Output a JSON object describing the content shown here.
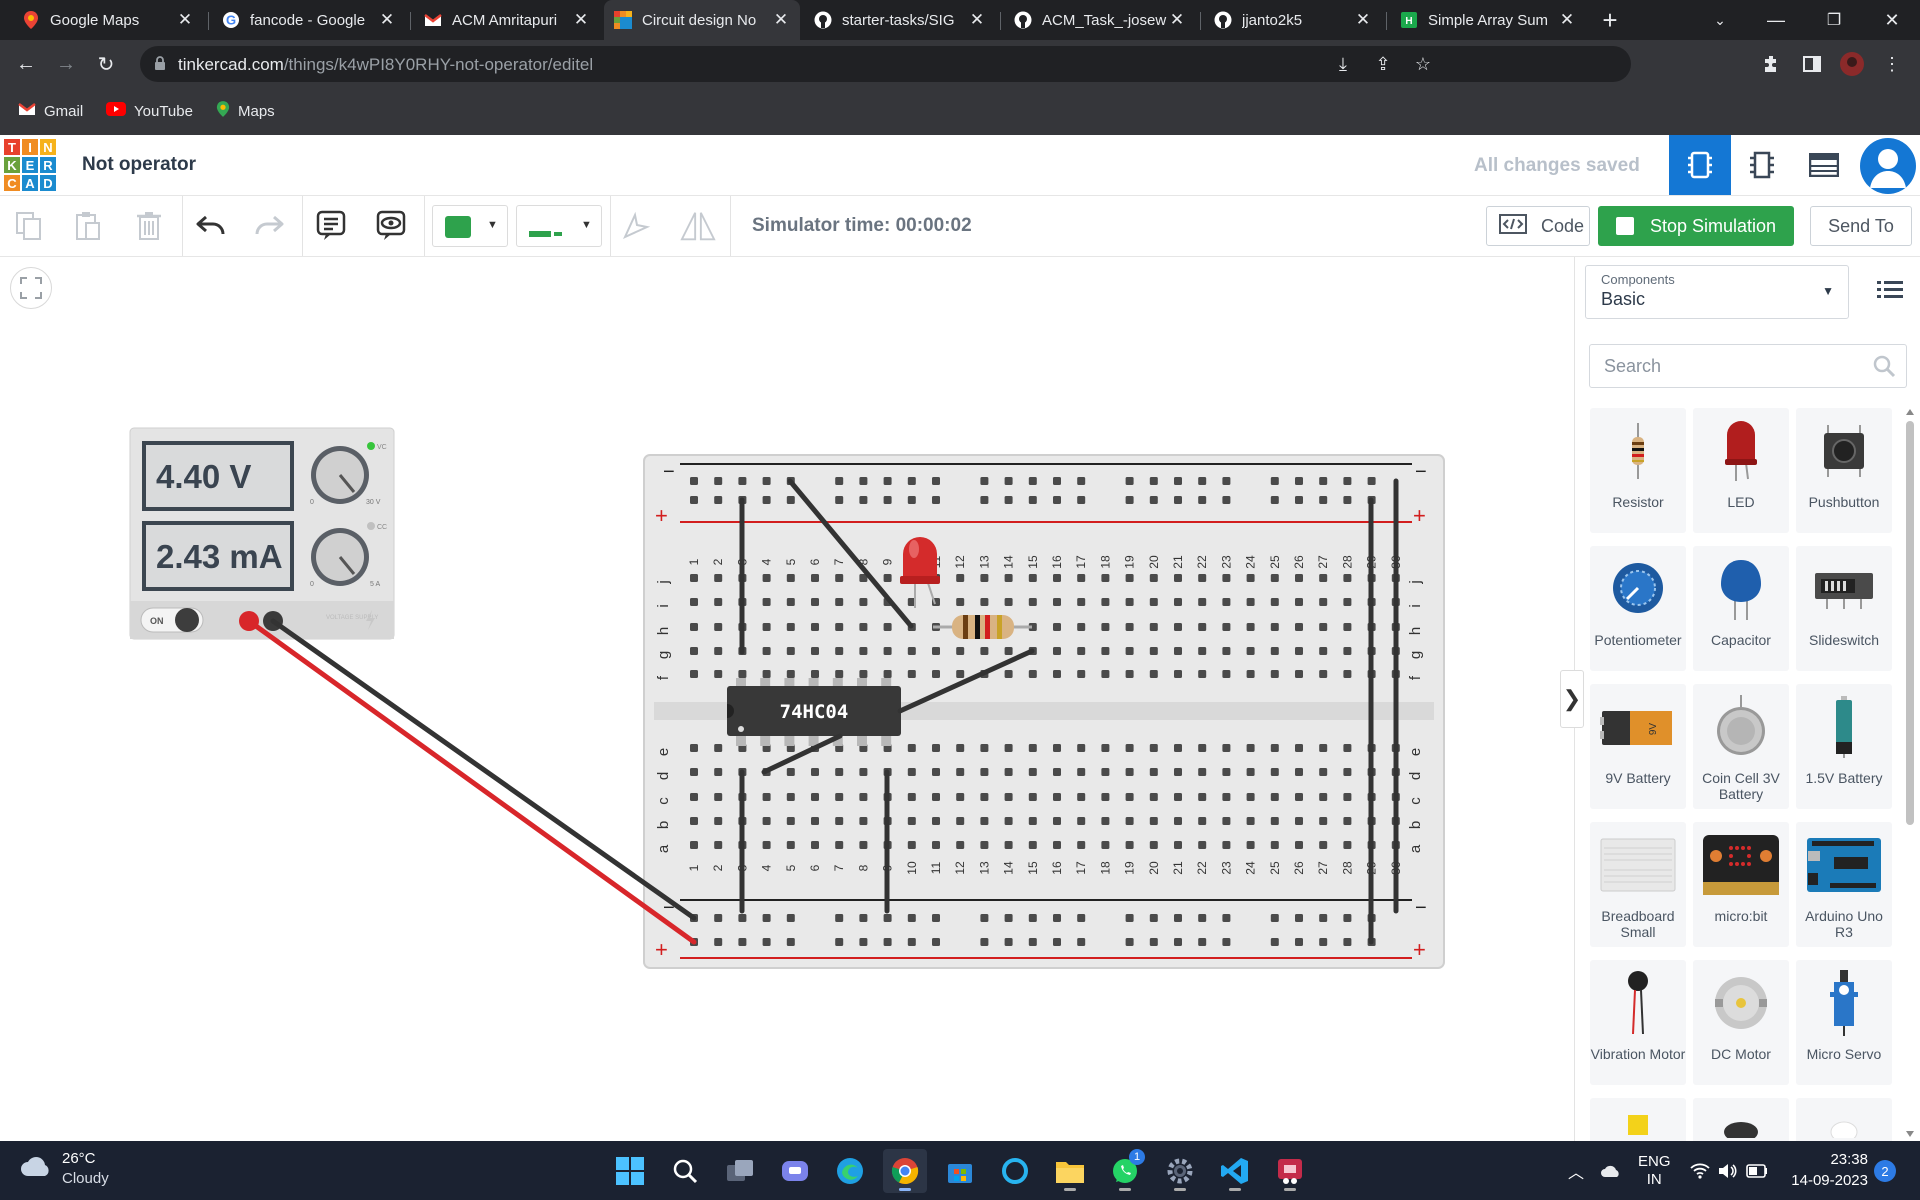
{
  "browser": {
    "tabs": [
      {
        "title": "Google Maps",
        "icon": "google-maps-icon"
      },
      {
        "title": "fancode - Google",
        "icon": "google-icon"
      },
      {
        "title": "ACM Amritapuri",
        "icon": "gmail-icon"
      },
      {
        "title": "Circuit design No",
        "icon": "tinkercad-icon",
        "active": true
      },
      {
        "title": "starter-tasks/SIG",
        "icon": "github-icon"
      },
      {
        "title": "ACM_Task_-josew",
        "icon": "github-icon"
      },
      {
        "title": "jjanto2k5",
        "icon": "github-icon"
      },
      {
        "title": "Simple Array Sum",
        "icon": "hackerrank-icon"
      }
    ],
    "url_host": "tinkercad.com",
    "url_path": "/things/k4wPI8Y0RHY-not-operator/editel",
    "bookmarks": [
      {
        "label": "Gmail",
        "icon": "gmail-icon"
      },
      {
        "label": "YouTube",
        "icon": "youtube-icon"
      },
      {
        "label": "Maps",
        "icon": "google-maps-icon"
      }
    ]
  },
  "tinkercad": {
    "logo_letters": [
      "T",
      "I",
      "N",
      "K",
      "E",
      "R",
      "C",
      "A",
      "D"
    ],
    "logo_colors": [
      "#e8412c",
      "#f08c22",
      "#f6b21b",
      "#6aa13c",
      "#1b8bcf",
      "#1b8bcf",
      "#f08c22",
      "#1b8bcf",
      "#1b8bcf"
    ],
    "design_title": "Not operator",
    "save_status": "All changes saved",
    "simulator_time": "Simulator time: 00:00:02",
    "code_label": "Code",
    "stop_label": "Stop Simulation",
    "send_to_label": "Send To",
    "accent_color": "#1477d4",
    "stop_color": "#2ea24c",
    "wire_color": "#2ea24c"
  },
  "circuit": {
    "power_supply": {
      "voltage": "4.40 V",
      "current": "2.43 mA",
      "switch_label": "ON",
      "vc_label": "VC",
      "cc_label": "CC",
      "v_min": "0",
      "v_max": "30 V",
      "a_min": "0",
      "a_max": "5 A",
      "brand": "VOLTAGE SUPPLY"
    },
    "chip_label": "74HC04",
    "row_labels_top": [
      "j",
      "i",
      "h",
      "g",
      "f"
    ],
    "row_labels_bottom": [
      "e",
      "d",
      "c",
      "b",
      "a"
    ],
    "column_numbers": [
      "1",
      "2",
      "3",
      "4",
      "5",
      "6",
      "7",
      "8",
      "9",
      "10",
      "11",
      "12",
      "13",
      "14",
      "15",
      "16",
      "17",
      "18",
      "19",
      "20",
      "21",
      "22",
      "23",
      "24",
      "25",
      "26",
      "27",
      "28",
      "29",
      "30"
    ],
    "minus_label": "−",
    "plus_label": "+"
  },
  "panel": {
    "components_label": "Components",
    "components_value": "Basic",
    "search_placeholder": "Search",
    "components": [
      {
        "name": "Resistor",
        "icon": "resistor-icon"
      },
      {
        "name": "LED",
        "icon": "led-icon"
      },
      {
        "name": "Pushbutton",
        "icon": "pushbutton-icon"
      },
      {
        "name": "Potentiometer",
        "icon": "potentiometer-icon"
      },
      {
        "name": "Capacitor",
        "icon": "capacitor-icon"
      },
      {
        "name": "Slideswitch",
        "icon": "slideswitch-icon"
      },
      {
        "name": "9V Battery",
        "icon": "battery-9v-icon"
      },
      {
        "name": "Coin Cell 3V Battery",
        "icon": "coin-cell-icon"
      },
      {
        "name": "1.5V Battery",
        "icon": "battery-aa-icon"
      },
      {
        "name": "Breadboard Small",
        "icon": "breadboard-icon"
      },
      {
        "name": "micro:bit",
        "icon": "microbit-icon"
      },
      {
        "name": "Arduino Uno R3",
        "icon": "arduino-icon"
      },
      {
        "name": "Vibration Motor",
        "icon": "vibration-motor-icon"
      },
      {
        "name": "DC Motor",
        "icon": "dc-motor-icon"
      },
      {
        "name": "Micro Servo",
        "icon": "micro-servo-icon"
      }
    ]
  },
  "taskbar": {
    "temperature": "26°C",
    "condition": "Cloudy",
    "language": "ENG",
    "region": "IN",
    "time": "23:38",
    "date": "14-09-2023",
    "notifications": "2",
    "whatsapp_badge": "1"
  }
}
